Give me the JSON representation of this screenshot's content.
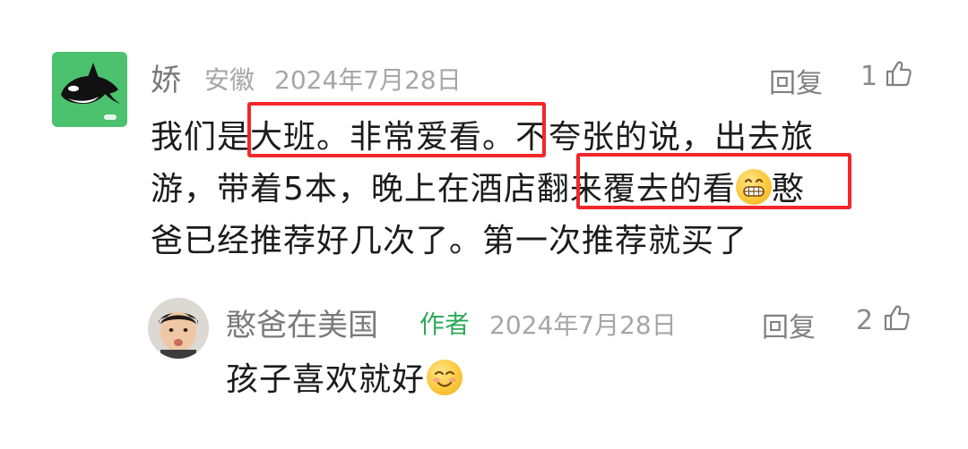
{
  "comment": {
    "username": "娇",
    "location": "安徽",
    "date": "2024年7月28日",
    "reply_label": "回复",
    "like_count": "1",
    "lines": [
      "我们是大班。非常爱看。不夸张的说，出去旅",
      "游，带着5本，晚上在酒店翻来覆去的看",
      "爸已经推荐好几次了。第一次推荐就买了"
    ],
    "line1_prefix": "我们是",
    "line1_highlight": "大班。非常爱看。",
    "line1_suffix": "不夸张的说，出去旅",
    "line2_prefix": "游，带着5本，晚上在酒店",
    "line2_highlight": "翻来覆去的看",
    "line2_suffix": "憨",
    "line3": "爸已经推荐好几次了。第一次推荐就买了",
    "emoji_icon": "grinning-face-icon"
  },
  "reply": {
    "username": "憨爸在美国",
    "author_tag": "作者",
    "date": "2024年7月28日",
    "reply_label": "回复",
    "like_count": "2",
    "text": "孩子喜欢就好",
    "emoji_icon": "smiling-face-icon"
  },
  "colors": {
    "highlight_border": "#f3262a",
    "author_tag": "#2eaa5a",
    "avatar_bg": "#4cc16e"
  }
}
